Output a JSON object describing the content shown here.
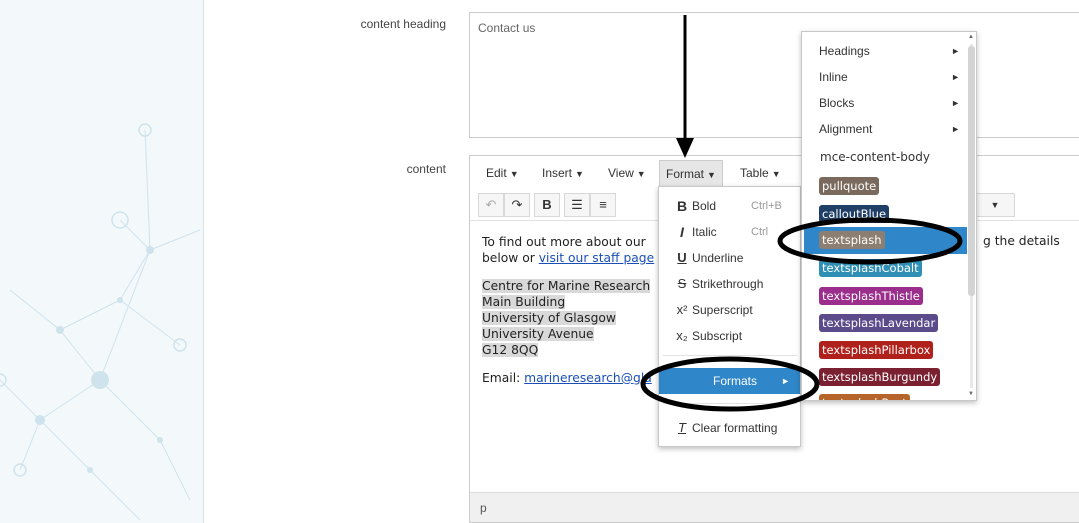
{
  "labels": {
    "content_heading": "content heading",
    "content": "content"
  },
  "heading_field": {
    "value": "Contact us"
  },
  "menubar": {
    "edit": "Edit",
    "insert": "Insert",
    "view": "View",
    "format": "Format",
    "table": "Table"
  },
  "toolbar": {
    "undo_icon": "undo-icon",
    "redo_icon": "redo-icon",
    "bold": "B",
    "align_icon": "align-left-icon",
    "list_icon": "bullet-list-icon"
  },
  "content": {
    "p1_line1": "To find out more about our",
    "p1_line1_right": "g the details",
    "p1_line2_prefix": "below or ",
    "p1_line2_link": "visit our staff page",
    "address": [
      "Centre for Marine Research",
      "Main Building",
      "University of Glasgow",
      "University Avenue",
      "G12 8QQ"
    ],
    "email_label": "Email: ",
    "email_link": "marineresearch@gla"
  },
  "statusbar": {
    "path": "p"
  },
  "format_menu": {
    "bold": "Bold",
    "bold_shortcut": "Ctrl+B",
    "italic": "Italic",
    "italic_shortcut": "Ctrl",
    "underline": "Underline",
    "strikethrough": "Strikethrough",
    "superscript": "Superscript",
    "subscript": "Subscript",
    "formats": "Formats",
    "clear_formatting": "Clear formatting"
  },
  "formats_submenu": {
    "headings": "Headings",
    "inline": "Inline",
    "blocks": "Blocks",
    "alignment": "Alignment",
    "content_body": "mce-content-body",
    "styles": [
      {
        "label": "pullquote",
        "color": "#7a6a5d"
      },
      {
        "label": "calloutBlue",
        "color": "#1f3f66"
      },
      {
        "label": "textsplash",
        "color": "#8c7e70"
      },
      {
        "label": "textsplashCobalt",
        "color": "#2f8fb5"
      },
      {
        "label": "textsplashThistle",
        "color": "#9b2e8c"
      },
      {
        "label": "textsplashLavendar",
        "color": "#5b4b8a"
      },
      {
        "label": "textsplashPillarbox",
        "color": "#b0211b"
      },
      {
        "label": "textsplashBurgundy",
        "color": "#7a2030"
      },
      {
        "label": "textsplashRust",
        "color": "#b5652a"
      }
    ]
  },
  "colors": {
    "highlight": "#2f86c8",
    "leftbar": "#f3f8fb",
    "annotation": "#000000"
  }
}
